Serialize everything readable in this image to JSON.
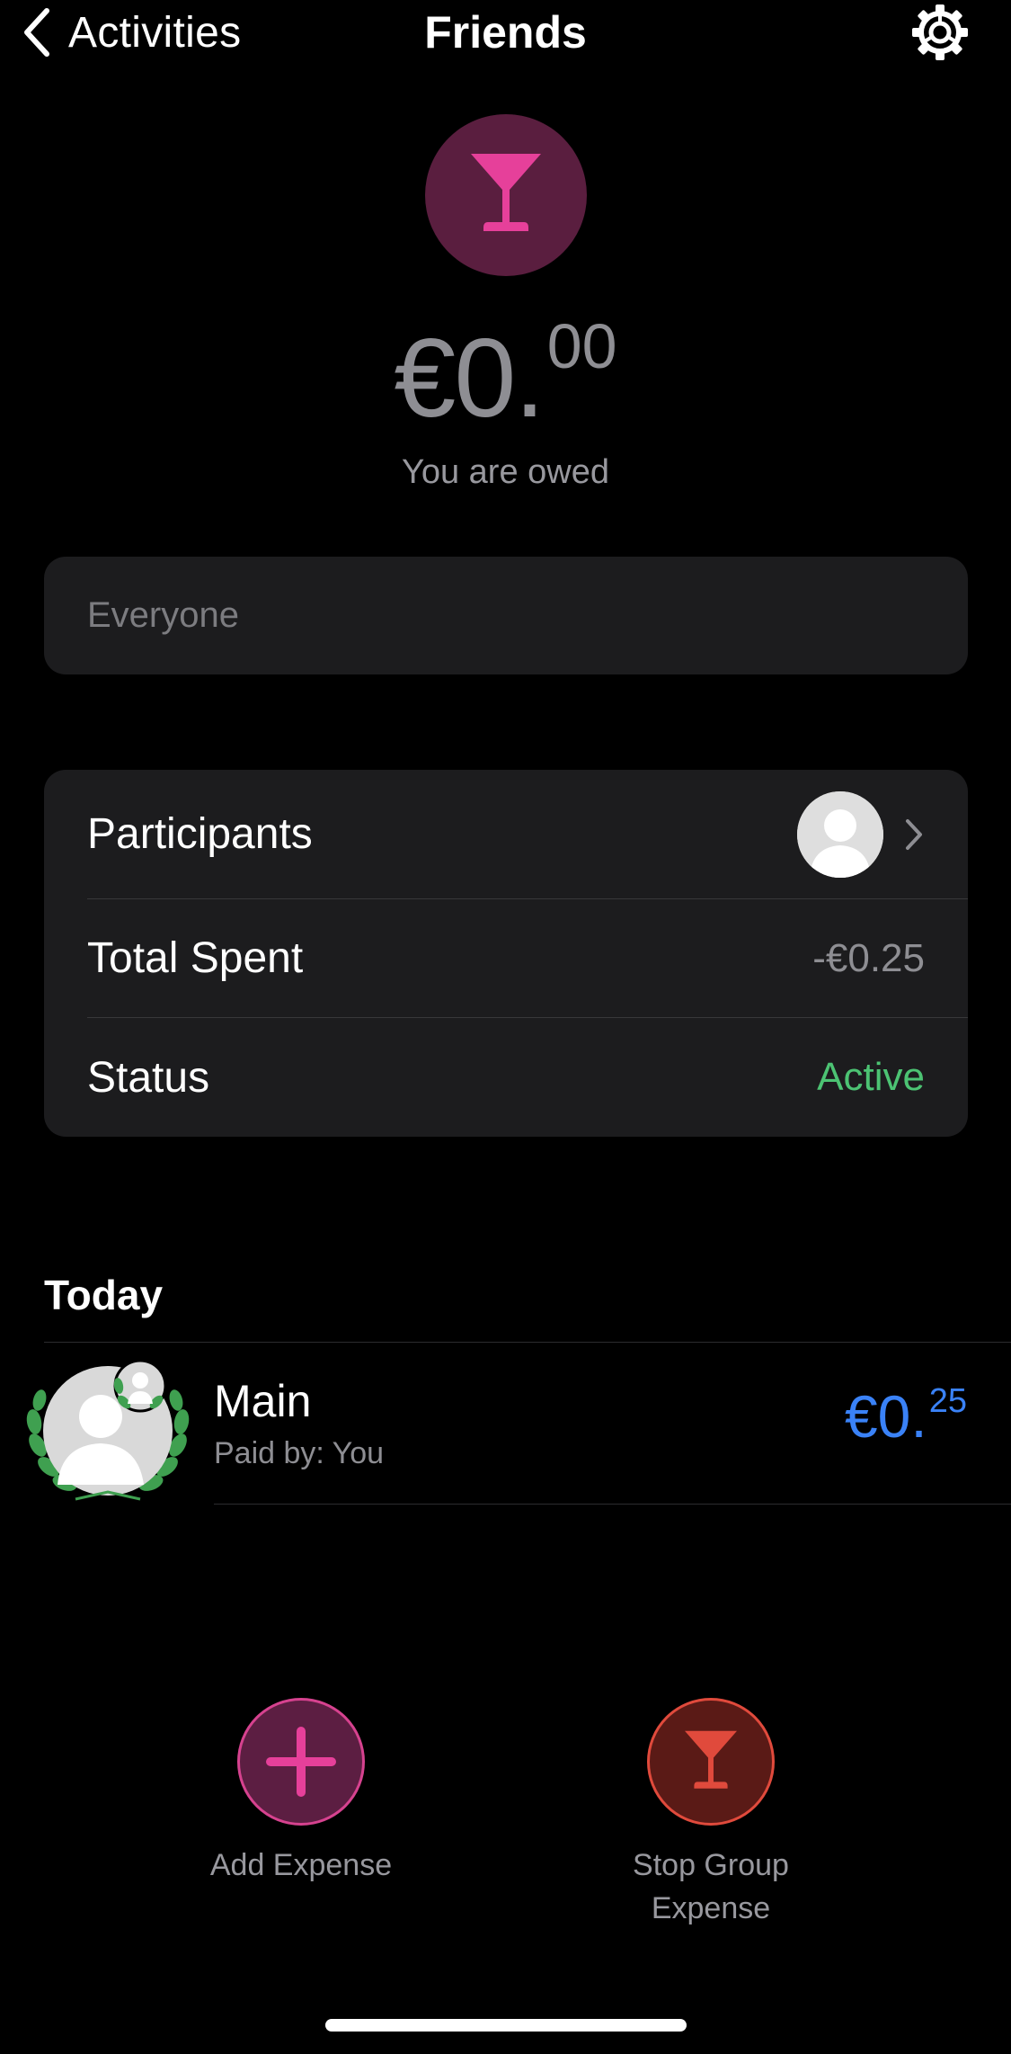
{
  "nav": {
    "back_label": "Activities",
    "title": "Friends",
    "settings_icon": "gear-icon"
  },
  "header": {
    "group_icon": "cocktail-glass-icon",
    "balance_main": "€0.",
    "balance_cents": "00",
    "balance_caption": "You are owed"
  },
  "filter": {
    "label": "Everyone"
  },
  "info": {
    "participants_label": "Participants",
    "total_spent_label": "Total Spent",
    "total_spent_value": "-€0.25",
    "status_label": "Status",
    "status_value": "Active"
  },
  "today": {
    "title": "Today",
    "expenses": [
      {
        "title": "Main",
        "paid_by": "Paid by: You",
        "amount_main": "€0.",
        "amount_cents": "25"
      }
    ]
  },
  "actions": {
    "add_label": "Add Expense",
    "stop_label": "Stop Group Expense"
  },
  "colors": {
    "background": "#000000",
    "card": "#1c1c1e",
    "accent_pink": "#d6428f",
    "accent_red": "#e04a3c",
    "status_active": "#4cc373",
    "amount_blue": "#3a82f7",
    "muted_text": "#8e8e93"
  }
}
